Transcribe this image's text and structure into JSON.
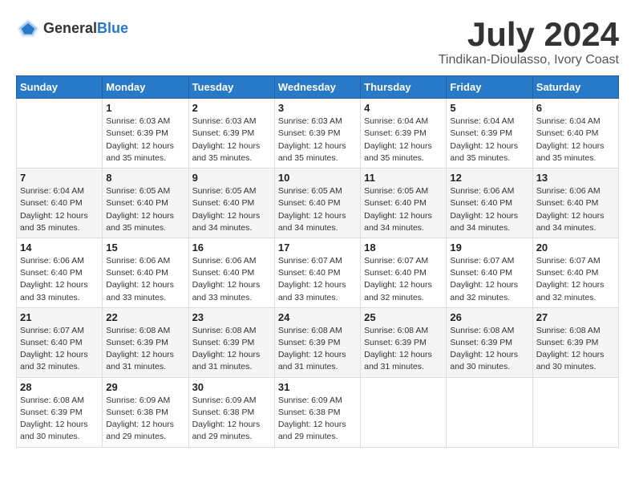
{
  "header": {
    "logo_general": "General",
    "logo_blue": "Blue",
    "month_title": "July 2024",
    "location": "Tindikan-Dioulasso, Ivory Coast"
  },
  "days_of_week": [
    "Sunday",
    "Monday",
    "Tuesday",
    "Wednesday",
    "Thursday",
    "Friday",
    "Saturday"
  ],
  "weeks": [
    [
      {
        "day": "",
        "info": ""
      },
      {
        "day": "1",
        "info": "Sunrise: 6:03 AM\nSunset: 6:39 PM\nDaylight: 12 hours\nand 35 minutes."
      },
      {
        "day": "2",
        "info": "Sunrise: 6:03 AM\nSunset: 6:39 PM\nDaylight: 12 hours\nand 35 minutes."
      },
      {
        "day": "3",
        "info": "Sunrise: 6:03 AM\nSunset: 6:39 PM\nDaylight: 12 hours\nand 35 minutes."
      },
      {
        "day": "4",
        "info": "Sunrise: 6:04 AM\nSunset: 6:39 PM\nDaylight: 12 hours\nand 35 minutes."
      },
      {
        "day": "5",
        "info": "Sunrise: 6:04 AM\nSunset: 6:39 PM\nDaylight: 12 hours\nand 35 minutes."
      },
      {
        "day": "6",
        "info": "Sunrise: 6:04 AM\nSunset: 6:40 PM\nDaylight: 12 hours\nand 35 minutes."
      }
    ],
    [
      {
        "day": "7",
        "info": "Sunrise: 6:04 AM\nSunset: 6:40 PM\nDaylight: 12 hours\nand 35 minutes."
      },
      {
        "day": "8",
        "info": "Sunrise: 6:05 AM\nSunset: 6:40 PM\nDaylight: 12 hours\nand 35 minutes."
      },
      {
        "day": "9",
        "info": "Sunrise: 6:05 AM\nSunset: 6:40 PM\nDaylight: 12 hours\nand 34 minutes."
      },
      {
        "day": "10",
        "info": "Sunrise: 6:05 AM\nSunset: 6:40 PM\nDaylight: 12 hours\nand 34 minutes."
      },
      {
        "day": "11",
        "info": "Sunrise: 6:05 AM\nSunset: 6:40 PM\nDaylight: 12 hours\nand 34 minutes."
      },
      {
        "day": "12",
        "info": "Sunrise: 6:06 AM\nSunset: 6:40 PM\nDaylight: 12 hours\nand 34 minutes."
      },
      {
        "day": "13",
        "info": "Sunrise: 6:06 AM\nSunset: 6:40 PM\nDaylight: 12 hours\nand 34 minutes."
      }
    ],
    [
      {
        "day": "14",
        "info": "Sunrise: 6:06 AM\nSunset: 6:40 PM\nDaylight: 12 hours\nand 33 minutes."
      },
      {
        "day": "15",
        "info": "Sunrise: 6:06 AM\nSunset: 6:40 PM\nDaylight: 12 hours\nand 33 minutes."
      },
      {
        "day": "16",
        "info": "Sunrise: 6:06 AM\nSunset: 6:40 PM\nDaylight: 12 hours\nand 33 minutes."
      },
      {
        "day": "17",
        "info": "Sunrise: 6:07 AM\nSunset: 6:40 PM\nDaylight: 12 hours\nand 33 minutes."
      },
      {
        "day": "18",
        "info": "Sunrise: 6:07 AM\nSunset: 6:40 PM\nDaylight: 12 hours\nand 32 minutes."
      },
      {
        "day": "19",
        "info": "Sunrise: 6:07 AM\nSunset: 6:40 PM\nDaylight: 12 hours\nand 32 minutes."
      },
      {
        "day": "20",
        "info": "Sunrise: 6:07 AM\nSunset: 6:40 PM\nDaylight: 12 hours\nand 32 minutes."
      }
    ],
    [
      {
        "day": "21",
        "info": "Sunrise: 6:07 AM\nSunset: 6:40 PM\nDaylight: 12 hours\nand 32 minutes."
      },
      {
        "day": "22",
        "info": "Sunrise: 6:08 AM\nSunset: 6:39 PM\nDaylight: 12 hours\nand 31 minutes."
      },
      {
        "day": "23",
        "info": "Sunrise: 6:08 AM\nSunset: 6:39 PM\nDaylight: 12 hours\nand 31 minutes."
      },
      {
        "day": "24",
        "info": "Sunrise: 6:08 AM\nSunset: 6:39 PM\nDaylight: 12 hours\nand 31 minutes."
      },
      {
        "day": "25",
        "info": "Sunrise: 6:08 AM\nSunset: 6:39 PM\nDaylight: 12 hours\nand 31 minutes."
      },
      {
        "day": "26",
        "info": "Sunrise: 6:08 AM\nSunset: 6:39 PM\nDaylight: 12 hours\nand 30 minutes."
      },
      {
        "day": "27",
        "info": "Sunrise: 6:08 AM\nSunset: 6:39 PM\nDaylight: 12 hours\nand 30 minutes."
      }
    ],
    [
      {
        "day": "28",
        "info": "Sunrise: 6:08 AM\nSunset: 6:39 PM\nDaylight: 12 hours\nand 30 minutes."
      },
      {
        "day": "29",
        "info": "Sunrise: 6:09 AM\nSunset: 6:38 PM\nDaylight: 12 hours\nand 29 minutes."
      },
      {
        "day": "30",
        "info": "Sunrise: 6:09 AM\nSunset: 6:38 PM\nDaylight: 12 hours\nand 29 minutes."
      },
      {
        "day": "31",
        "info": "Sunrise: 6:09 AM\nSunset: 6:38 PM\nDaylight: 12 hours\nand 29 minutes."
      },
      {
        "day": "",
        "info": ""
      },
      {
        "day": "",
        "info": ""
      },
      {
        "day": "",
        "info": ""
      }
    ]
  ]
}
